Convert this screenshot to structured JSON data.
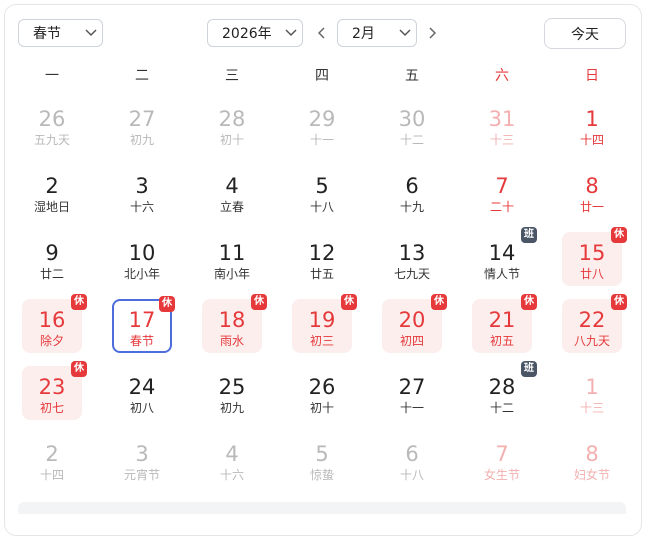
{
  "toolbar": {
    "holiday_select": "春节",
    "year_select": "2026年",
    "month_select": "2月",
    "today_label": "今天"
  },
  "weekdays": [
    {
      "label": "一",
      "weekend": false
    },
    {
      "label": "二",
      "weekend": false
    },
    {
      "label": "三",
      "weekend": false
    },
    {
      "label": "四",
      "weekend": false
    },
    {
      "label": "五",
      "weekend": false
    },
    {
      "label": "六",
      "weekend": true
    },
    {
      "label": "日",
      "weekend": true
    }
  ],
  "days": [
    {
      "day": "26",
      "lunar": "五九天",
      "other": true
    },
    {
      "day": "27",
      "lunar": "初九",
      "other": true
    },
    {
      "day": "28",
      "lunar": "初十",
      "other": true
    },
    {
      "day": "29",
      "lunar": "十一",
      "other": true
    },
    {
      "day": "30",
      "lunar": "十二",
      "other": true
    },
    {
      "day": "31",
      "lunar": "十三",
      "other": true,
      "weekend": true
    },
    {
      "day": "1",
      "lunar": "十四",
      "weekend": true
    },
    {
      "day": "2",
      "lunar": "湿地日"
    },
    {
      "day": "3",
      "lunar": "十六"
    },
    {
      "day": "4",
      "lunar": "立春"
    },
    {
      "day": "5",
      "lunar": "十八"
    },
    {
      "day": "6",
      "lunar": "十九"
    },
    {
      "day": "7",
      "lunar": "二十",
      "weekend": true
    },
    {
      "day": "8",
      "lunar": "廿一",
      "weekend": true
    },
    {
      "day": "9",
      "lunar": "廿二"
    },
    {
      "day": "10",
      "lunar": "北小年"
    },
    {
      "day": "11",
      "lunar": "南小年"
    },
    {
      "day": "12",
      "lunar": "廿五"
    },
    {
      "day": "13",
      "lunar": "七九天"
    },
    {
      "day": "14",
      "lunar": "情人节",
      "badge": "班",
      "badge_type": "work"
    },
    {
      "day": "15",
      "lunar": "廿八",
      "holiday": true,
      "badge": "休",
      "badge_type": "rest"
    },
    {
      "day": "16",
      "lunar": "除夕",
      "holiday": true,
      "badge": "休",
      "badge_type": "rest"
    },
    {
      "day": "17",
      "lunar": "春节",
      "holiday": true,
      "selected": true,
      "badge": "休",
      "badge_type": "rest"
    },
    {
      "day": "18",
      "lunar": "雨水",
      "holiday": true,
      "badge": "休",
      "badge_type": "rest"
    },
    {
      "day": "19",
      "lunar": "初三",
      "holiday": true,
      "badge": "休",
      "badge_type": "rest"
    },
    {
      "day": "20",
      "lunar": "初四",
      "holiday": true,
      "badge": "休",
      "badge_type": "rest"
    },
    {
      "day": "21",
      "lunar": "初五",
      "holiday": true,
      "badge": "休",
      "badge_type": "rest"
    },
    {
      "day": "22",
      "lunar": "八九天",
      "holiday": true,
      "badge": "休",
      "badge_type": "rest"
    },
    {
      "day": "23",
      "lunar": "初七",
      "holiday": true,
      "badge": "休",
      "badge_type": "rest"
    },
    {
      "day": "24",
      "lunar": "初八"
    },
    {
      "day": "25",
      "lunar": "初九"
    },
    {
      "day": "26",
      "lunar": "初十"
    },
    {
      "day": "27",
      "lunar": "十一"
    },
    {
      "day": "28",
      "lunar": "十二",
      "badge": "班",
      "badge_type": "work"
    },
    {
      "day": "1",
      "lunar": "十三",
      "other": true,
      "weekend": true
    },
    {
      "day": "2",
      "lunar": "十四",
      "other": true
    },
    {
      "day": "3",
      "lunar": "元宵节",
      "other": true
    },
    {
      "day": "4",
      "lunar": "十六",
      "other": true
    },
    {
      "day": "5",
      "lunar": "惊蛰",
      "other": true
    },
    {
      "day": "6",
      "lunar": "十八",
      "other": true
    },
    {
      "day": "7",
      "lunar": "女生节",
      "other": true,
      "weekend": true
    },
    {
      "day": "8",
      "lunar": "妇女节",
      "other": true,
      "weekend": true
    }
  ],
  "icons": {
    "chevron_down": "chevron-down-icon",
    "prev": "chevron-left-icon",
    "next": "chevron-right-icon"
  },
  "colors": {
    "holiday_red": "#e5393b",
    "work_badge": "#4a5566",
    "selected_border": "#4e6ddc"
  }
}
